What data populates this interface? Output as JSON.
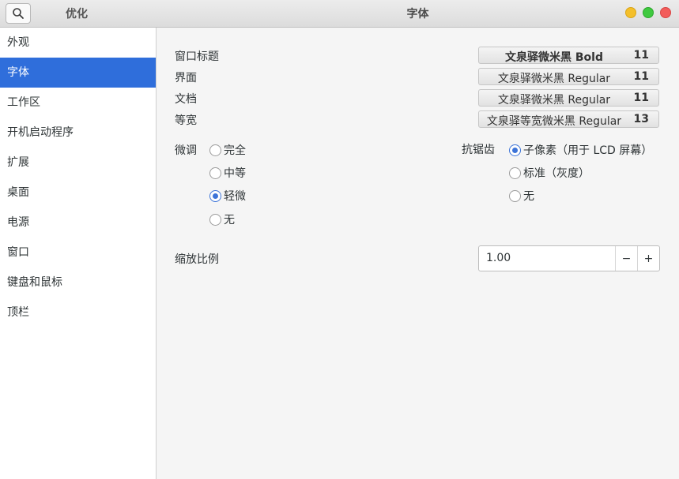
{
  "titlebar": {
    "sidebar_title": "优化",
    "window_title": "字体",
    "search_icon": "search-icon",
    "colors": {
      "minimize": "#f4bf2a",
      "maximize": "#3fc93f",
      "close": "#f25d5b"
    }
  },
  "sidebar": {
    "accent": "#2f6edb",
    "items": [
      {
        "label": "外观",
        "active": false
      },
      {
        "label": "字体",
        "active": true
      },
      {
        "label": "工作区",
        "active": false
      },
      {
        "label": "开机启动程序",
        "active": false
      },
      {
        "label": "扩展",
        "active": false
      },
      {
        "label": "桌面",
        "active": false
      },
      {
        "label": "电源",
        "active": false
      },
      {
        "label": "窗口",
        "active": false
      },
      {
        "label": "键盘和鼠标",
        "active": false
      },
      {
        "label": "顶栏",
        "active": false
      }
    ]
  },
  "fonts": {
    "rows": [
      {
        "label": "窗口标题",
        "font": "文泉驿微米黑 Bold",
        "size": "11"
      },
      {
        "label": "界面",
        "font": "文泉驿微米黑 Regular",
        "size": "11"
      },
      {
        "label": "文档",
        "font": "文泉驿微米黑 Regular",
        "size": "11"
      },
      {
        "label": "等宽",
        "font": "文泉驿等宽微米黑 Regular",
        "size": "13"
      }
    ]
  },
  "hinting": {
    "label": "微调",
    "options": [
      {
        "label": "完全",
        "selected": false
      },
      {
        "label": "中等",
        "selected": false
      },
      {
        "label": "轻微",
        "selected": true
      },
      {
        "label": "无",
        "selected": false
      }
    ]
  },
  "antialiasing": {
    "label": "抗锯齿",
    "options": [
      {
        "label": "子像素（用于 LCD 屏幕）",
        "selected": true
      },
      {
        "label": "标准（灰度）",
        "selected": false
      },
      {
        "label": "无",
        "selected": false
      }
    ]
  },
  "scaling": {
    "label": "缩放比例",
    "value": "1.00",
    "minus": "−",
    "plus": "+"
  }
}
